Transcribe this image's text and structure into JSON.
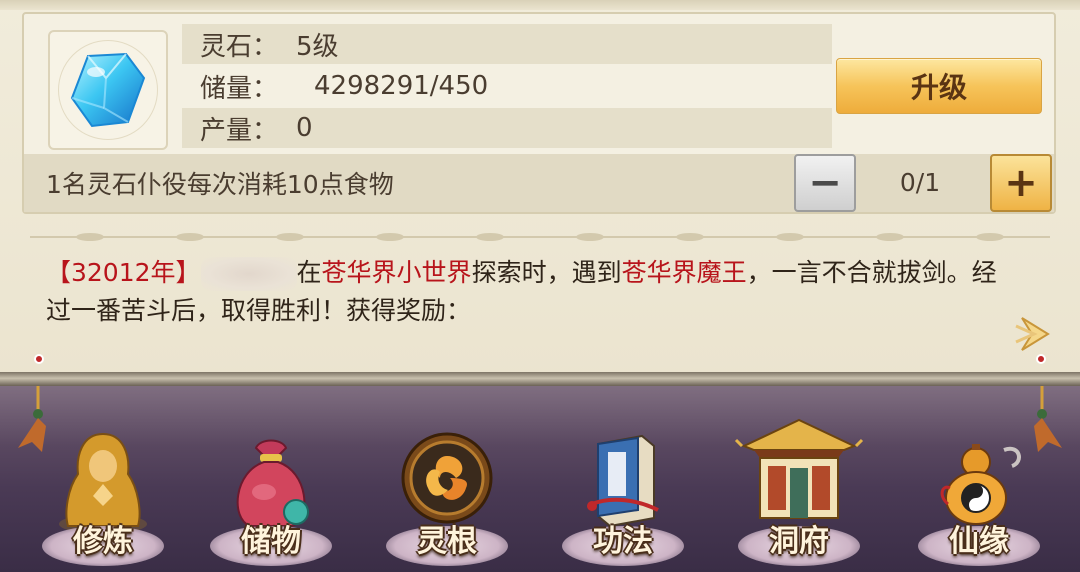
{
  "building": {
    "icon": "spirit-stone-gem-icon",
    "rows": [
      {
        "label": "灵石：",
        "value": "5级"
      },
      {
        "label": "储量：",
        "value": "4298291/450"
      },
      {
        "label": "产量：",
        "value": "0"
      }
    ],
    "upgrade_label": "升级"
  },
  "servant": {
    "text": "1名灵石仆役每次消耗10点食物",
    "minus_label": "−",
    "plus_label": "+",
    "count": "0/1"
  },
  "log": {
    "year": "【32012年】",
    "part_in": "在",
    "place": "苍华界小世界",
    "part_explore": "探索时，遇到",
    "enemy": "苍华界魔王",
    "part_rest": "，一言不合就拔剑。经过一番苦斗后，取得胜利！获得奖励："
  },
  "nav": {
    "items": [
      {
        "label": "修炼",
        "icon": "meditating-monk-icon"
      },
      {
        "label": "储物",
        "icon": "treasure-bag-icon"
      },
      {
        "label": "灵根",
        "icon": "triskelion-orb-icon"
      },
      {
        "label": "功法",
        "icon": "scripture-book-icon"
      },
      {
        "label": "洞府",
        "icon": "pavilion-icon"
      },
      {
        "label": "仙缘",
        "icon": "gourd-yinyang-icon"
      }
    ]
  },
  "colors": {
    "highlight_text": "#b8141b",
    "upgrade_button": "#f6c45a",
    "nav_background": "#4a3a55"
  }
}
